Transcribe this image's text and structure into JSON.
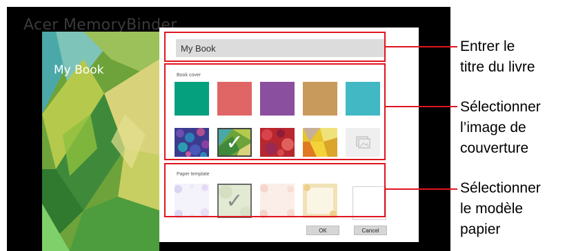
{
  "app": {
    "title": "Acer MemoryBinder",
    "cover_title": "My Book"
  },
  "dialog": {
    "title_input_value": "My Book",
    "book_cover_label": "Book cover",
    "paper_template_label": "Paper template",
    "color_swatches": [
      "#05a07e",
      "#e06565",
      "#8a4f9e",
      "#c89a5c",
      "#42b8c4"
    ],
    "image_covers": [
      "mosaic-blue",
      "green-triangles",
      "red-bokeh",
      "yellow-polygons",
      "add-picture"
    ],
    "selected_cover": "green-triangles",
    "paper_templates": [
      "blue-dots",
      "green-gray",
      "peach-dots",
      "cream-frame",
      "plain-white"
    ],
    "selected_paper": "green-gray",
    "ok_label": "OK",
    "cancel_label": "Cancel"
  },
  "annotations": {
    "title": [
      "Entrer le",
      "titre du livre"
    ],
    "cover": [
      "Sélectionner",
      "l’image de",
      "couverture"
    ],
    "paper": [
      "Sélectionner",
      "le modèle",
      "papier"
    ],
    "color": "#e0141e"
  }
}
